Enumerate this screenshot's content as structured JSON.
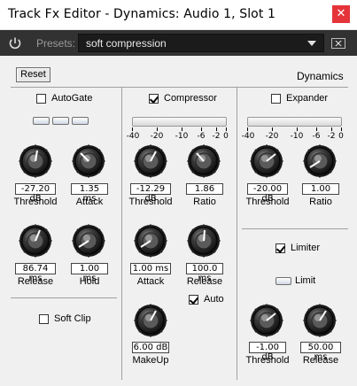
{
  "window": {
    "title": "Track Fx Editor - Dynamics: Audio 1, Slot 1",
    "close_glyph": "✕"
  },
  "presets": {
    "label": "Presets:",
    "selected": "soft compression",
    "icons": {
      "power": "power-icon",
      "menu": "preset-menu-icon",
      "dropdown": "chevron-down-icon"
    }
  },
  "panel": {
    "reset_label": "Reset",
    "title": "Dynamics"
  },
  "autogate": {
    "label": "AutoGate",
    "checked": false,
    "threshold": {
      "value": "-27.20 dB",
      "label": "Threshold"
    },
    "attack": {
      "value": "1.35 ms",
      "label": "Attack"
    },
    "release": {
      "value": "86.74 ms",
      "label": "Release"
    },
    "hold": {
      "value": "1.00 ms",
      "label": "Hold"
    }
  },
  "softclip": {
    "label": "Soft Clip",
    "checked": false
  },
  "compressor": {
    "label": "Compressor",
    "checked": true,
    "scale": [
      "-40",
      "-20",
      "-10",
      "-6",
      "-2",
      "0"
    ],
    "threshold": {
      "value": "-12.29 dB",
      "label": "Threshold"
    },
    "ratio": {
      "value": "1.86",
      "label": "Ratio"
    },
    "attack": {
      "value": "1.00 ms",
      "label": "Attack"
    },
    "release": {
      "value": "100.0 ms",
      "label": "Release"
    },
    "auto": {
      "label": "Auto",
      "checked": true
    },
    "makeup": {
      "value": "6.00 dB",
      "label": "MakeUp"
    }
  },
  "expander": {
    "label": "Expander",
    "checked": false,
    "scale": [
      "-40",
      "-20",
      "-10",
      "-6",
      "-2",
      "0"
    ],
    "threshold": {
      "value": "-20.00 dB",
      "label": "Threshold"
    },
    "ratio": {
      "value": "1.00",
      "label": "Ratio"
    }
  },
  "limiter": {
    "label": "Limiter",
    "checked": true,
    "limit_label": "Limit",
    "threshold": {
      "value": "-1.00 dB",
      "label": "Threshold"
    },
    "release": {
      "value": "50.00 ms",
      "label": "Release"
    }
  }
}
